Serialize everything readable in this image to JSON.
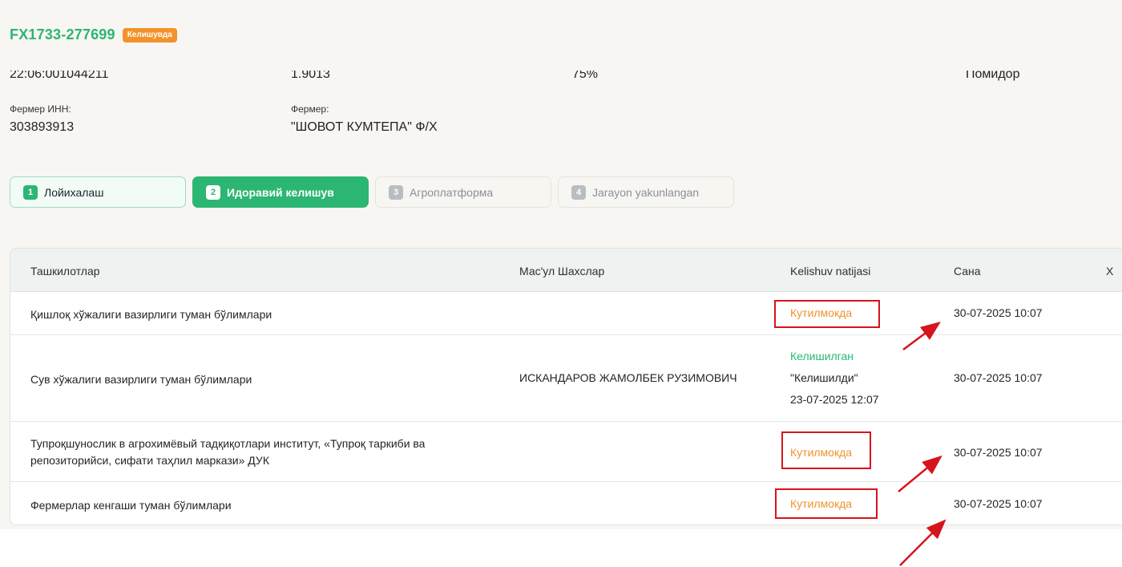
{
  "header": {
    "application_id": "FX1733-277699",
    "status_badge": "Келишувда"
  },
  "info_top_row": [
    "22:06:001044211",
    "1.9013",
    "75%",
    "Помидор"
  ],
  "info": {
    "farmer_inn_label": "Фермер ИНН:",
    "farmer_inn_value": "303893913",
    "farmer_label": "Фермер:",
    "farmer_value": "\"ШОВОТ КУМТЕПА\" Ф/Х"
  },
  "steps": [
    {
      "num": "1",
      "label": "Лойихалаш",
      "state": "done"
    },
    {
      "num": "2",
      "label": "Идоравий келишув",
      "state": "active"
    },
    {
      "num": "3",
      "label": "Агроплатформа",
      "state": "inactive"
    },
    {
      "num": "4",
      "label": "Jarayon yakunlangan",
      "state": "inactive"
    }
  ],
  "table": {
    "columns": [
      "Ташкилотлар",
      "Мас'ул Шахслар",
      "Kelishuv natijasi",
      "Сана",
      "Х"
    ],
    "rows": [
      {
        "organization": "Қишлоқ хўжалиги вазирлиги туман бўлимлари",
        "responsible": "",
        "result": "Кутилмокда",
        "date": "30-07-2025 10:07"
      },
      {
        "organization": "Сув хўжалиги вазирлиги туман бўлимлари",
        "responsible": "ИСКАНДАРОВ ЖАМОЛБЕК РУЗИМОВИЧ",
        "result": "Келишилган",
        "result_comment": "\"Келишилди\"",
        "result_date": "23-07-2025 12:07",
        "date": "30-07-2025 10:07"
      },
      {
        "organization_line1": "Тупроқшунослик в агрохимёвый тадқиқотлари институт, «Тупроқ таркиби ва",
        "organization_line2": "репозиторийси, сифати таҳлил маркази» ДУК",
        "responsible": "",
        "result": "Кутилмокда",
        "date": "30-07-2025 10:07"
      },
      {
        "organization": "Фермерлар кенгаши туман бўлимлари",
        "responsible": "",
        "result": "Кутилмокда",
        "date": "30-07-2025 10:07"
      }
    ]
  },
  "colors": {
    "brand_green": "#2bb673",
    "pending_orange": "#f2922a",
    "annotation_red": "#d6141c"
  }
}
